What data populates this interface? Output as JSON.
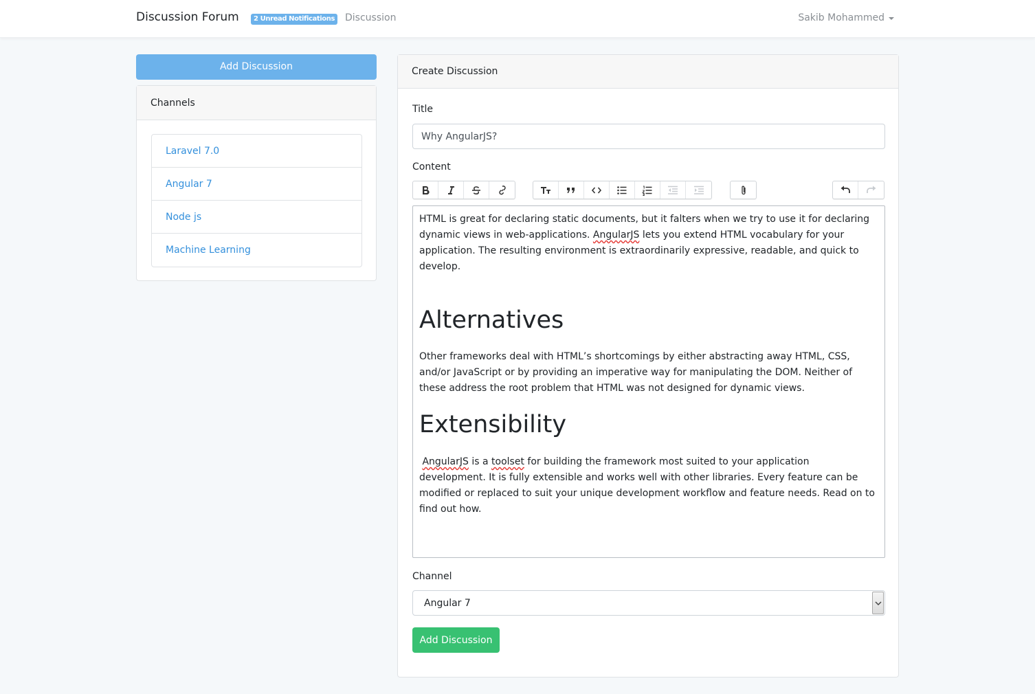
{
  "navbar": {
    "brand": "Discussion Forum",
    "notifications_badge": "2 Unread Notifications",
    "discussion_link": "Discussion",
    "user_name": "Sakib Mohammed"
  },
  "sidebar": {
    "add_button": "Add Discussion",
    "channels_title": "Channels",
    "channels": [
      "Laravel 7.0",
      "Angular 7",
      "Node js",
      "Machine Learning"
    ]
  },
  "form": {
    "header": "Create Discussion",
    "title_label": "Title",
    "title_value": "Why AngularJS?",
    "content_label": "Content",
    "toolbar": {
      "icons": [
        "bold-icon",
        "italic-icon",
        "strikethrough-icon",
        "link-icon",
        "heading-icon",
        "quote-icon",
        "code-icon",
        "bullet-list-icon",
        "numbered-list-icon",
        "outdent-icon",
        "indent-icon",
        "attach-icon",
        "undo-icon",
        "redo-icon"
      ]
    },
    "content": {
      "p1_pre": " HTML is great for declaring static documents, but it falters when we try to use it for declaring dynamic views in web-applications. ",
      "p1_sq": "AngularJS",
      "p1_post": " lets you extend HTML vocabulary for your application. The resulting environment is extraordinarily expressive, readable, and quick to develop.",
      "h1": "Alternatives",
      "p2": " Other frameworks deal with HTML’s shortcomings by either abstracting away HTML, CSS, and/or JavaScript or by providing an imperative way for manipulating the DOM. Neither of these address the root problem that HTML was not designed for dynamic views.",
      "h2": "Extensibility",
      "p3_sq1": "AngularJS",
      "p3_mid": " is a ",
      "p3_sq2": "toolset",
      "p3_post": " for building the framework most suited to your application development. It is fully extensible and works well with other libraries. Every feature can be modified or replaced to suit your unique development workflow and feature needs. Read on to find out how."
    },
    "channel_label": "Channel",
    "channel_selected": "Angular 7",
    "submit_button": "Add Discussion"
  },
  "colors": {
    "primary": "#6cb2eb",
    "link": "#3490dc",
    "success": "#38c172",
    "background": "#f5f8fa"
  }
}
